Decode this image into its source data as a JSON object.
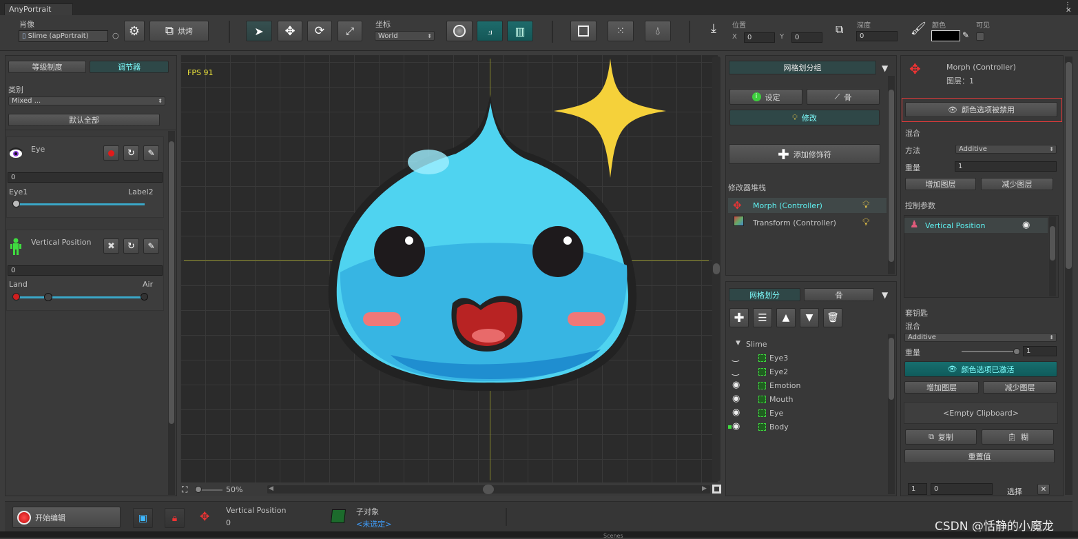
{
  "window": {
    "title": "AnyPortrait"
  },
  "toolbar": {
    "portrait_label": "肖像",
    "portrait_value": "Slime (apPortrait)",
    "bake_label": "烘烤",
    "coord_label": "坐标",
    "coord_value": "World",
    "position_label": "位置",
    "pos_x_label": "X",
    "pos_x": "0",
    "pos_y_label": "Y",
    "pos_y": "0",
    "depth_label": "深度",
    "depth": "0",
    "color_label": "颜色",
    "visible_label": "可见"
  },
  "left_panel": {
    "tab_hierarchy": "等级制度",
    "tab_controller": "调节器",
    "category_label": "类别",
    "category_value": "Mixed ...",
    "default_all": "默认全部",
    "params": [
      {
        "name": "Eye",
        "value": "0",
        "min_label": "Eye1",
        "max_label": "Label2",
        "fraction": 0.0
      },
      {
        "name": "Vertical Position",
        "value": "0",
        "min_label": "Land",
        "max_label": "Air",
        "fraction": 0.24
      }
    ]
  },
  "viewport": {
    "fps": "FPS 91",
    "zoom": "50%",
    "accent": "#f5d13a",
    "slime_color": "#4fd3f0"
  },
  "mesh_group_panel": {
    "title": "网格划分组",
    "btn_setting": "设定",
    "btn_bone": "骨",
    "btn_modify": "修改",
    "btn_add_modifier": "添加修饰符",
    "stack_label": "修改器堆栈",
    "modifiers": [
      {
        "name": "Morph (Controller)",
        "selected": true
      },
      {
        "name": "Transform (Controller)",
        "selected": false
      }
    ]
  },
  "mesh_panel": {
    "tab_mesh": "网格划分",
    "tab_bone": "骨",
    "root": "Slime",
    "items": [
      {
        "name": "Eye3",
        "vis": "closed"
      },
      {
        "name": "Eye2",
        "vis": "closed"
      },
      {
        "name": "Emotion",
        "vis": "open"
      },
      {
        "name": "Mouth",
        "vis": "open"
      },
      {
        "name": "Eye",
        "vis": "open"
      },
      {
        "name": "Body",
        "vis": "open"
      }
    ]
  },
  "right_panel": {
    "title": "Morph (Controller)",
    "layer": "图层：1",
    "color_disabled": "颜色选项被禁用",
    "blend_label": "混合",
    "method_label": "方法",
    "method_value": "Additive",
    "weight_label": "重量",
    "weight_value": "1",
    "add_layer": "增加图层",
    "remove_layer": "减少图层",
    "control_params_label": "控制参数",
    "control_param": "Vertical Position",
    "keyframe_label": "套钥匙",
    "blend2_label": "混合",
    "blend2_value": "Additive",
    "weight2_label": "重量",
    "weight2_value": "1",
    "color_enabled": "颜色选项已激活",
    "add_layer2": "增加图层",
    "remove_layer2": "减少图层",
    "clipboard": "<Empty Clipboard>",
    "copy": "复制",
    "paste": "糊",
    "reset": "重置值",
    "bottom_a": "1",
    "bottom_b": "0",
    "select": "选择"
  },
  "statusbar": {
    "start_edit": "开始编辑",
    "param_name": "Vertical Position",
    "param_value": "0",
    "child_label": "子对象",
    "child_value": "<未选定>",
    "watermark": "CSDN @恬静的小魔龙",
    "behind_text": "Scenes"
  }
}
